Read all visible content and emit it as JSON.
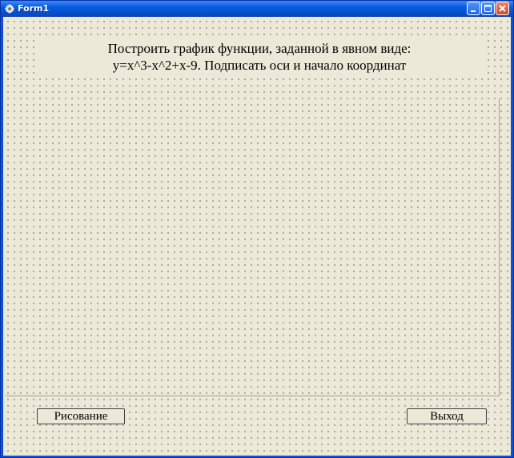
{
  "window": {
    "title": "Form1"
  },
  "heading": {
    "line1": "Построить график функции, заданной в явном виде:",
    "line2": "y=x^3-x^2+x-9. Подписать оси и начало координат"
  },
  "buttons": {
    "draw_label": "Рисование",
    "exit_label": "Выход"
  },
  "colors": {
    "titlebar": "#0a5ce0",
    "form_background": "#ece9d8",
    "close_button": "#d2492b"
  },
  "icons": [
    "app-icon",
    "minimize-icon",
    "maximize-icon",
    "close-icon"
  ]
}
